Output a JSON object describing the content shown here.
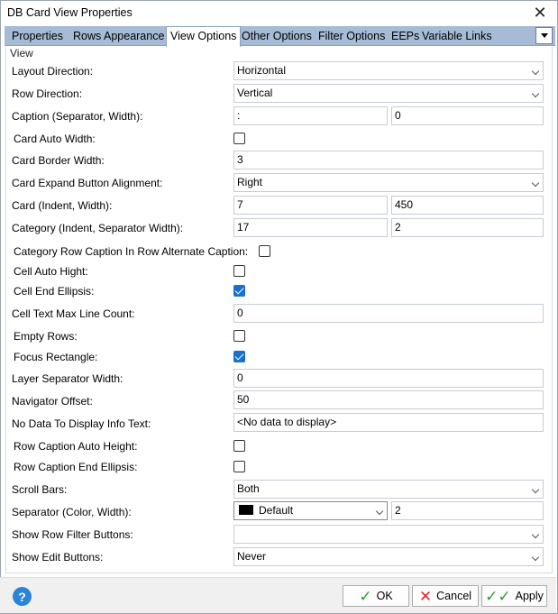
{
  "window": {
    "title": "DB Card View Properties"
  },
  "tabs": [
    {
      "label": "Properties"
    },
    {
      "label": "Rows"
    },
    {
      "label": "Appearance"
    },
    {
      "label": "View Options"
    },
    {
      "label": "Other Options"
    },
    {
      "label": "Filter Options"
    },
    {
      "label": "EEPs"
    },
    {
      "label": "Variable Links"
    }
  ],
  "active_tab": "View Options",
  "group": {
    "title": "View"
  },
  "rows": {
    "layout_direction": {
      "label": "Layout Direction:",
      "value": "Horizontal"
    },
    "row_direction": {
      "label": "Row Direction:",
      "value": "Vertical"
    },
    "caption": {
      "label": "Caption (Separator, Width):",
      "separator": ":",
      "width": "0"
    },
    "card_auto_width": {
      "label": "Card Auto Width:",
      "checked": false
    },
    "card_border_width": {
      "label": "Card Border Width:",
      "value": "3"
    },
    "card_expand_alignment": {
      "label": "Card Expand Button Alignment:",
      "value": "Right"
    },
    "card_indent": {
      "label": "Card (Indent, Width):",
      "indent": "7",
      "width": "450"
    },
    "category_indent": {
      "label": "Category (Indent, Separator Width):",
      "indent": "17",
      "separator_width": "2"
    },
    "category_row_caption": {
      "label": "Category Row Caption In Row Alternate Caption:",
      "checked": false
    },
    "cell_auto_hight": {
      "label": "Cell Auto Hight:",
      "checked": false
    },
    "cell_end_ellipsis": {
      "label": "Cell End Ellipsis:",
      "checked": true
    },
    "cell_text_max_line": {
      "label": "Cell Text Max Line Count:",
      "value": "0"
    },
    "empty_rows": {
      "label": "Empty Rows:",
      "checked": false
    },
    "focus_rectangle": {
      "label": "Focus Rectangle:",
      "checked": true
    },
    "layer_separator_width": {
      "label": "Layer Separator Width:",
      "value": "0"
    },
    "navigator_offset": {
      "label": "Navigator Offset:",
      "value": "50"
    },
    "no_data_text": {
      "label": "No Data To Display Info Text:",
      "value": "<No data to display>"
    },
    "row_caption_auto_height": {
      "label": "Row Caption Auto Height:",
      "checked": false
    },
    "row_caption_end_ellipsis": {
      "label": "Row Caption End Ellipsis:",
      "checked": false
    },
    "scroll_bars": {
      "label": "Scroll Bars:",
      "value": "Both"
    },
    "separator": {
      "label": "Separator (Color, Width):",
      "color_name": "Default",
      "color_hex": "#000000",
      "width": "2"
    },
    "show_row_filter_buttons": {
      "label": "Show Row Filter Buttons:",
      "value": ""
    },
    "show_edit_buttons": {
      "label": "Show Edit Buttons:",
      "value": "Never"
    }
  },
  "footer": {
    "help_glyph": "?",
    "ok_label": "OK",
    "cancel_label": "Cancel",
    "apply_label": "Apply"
  }
}
